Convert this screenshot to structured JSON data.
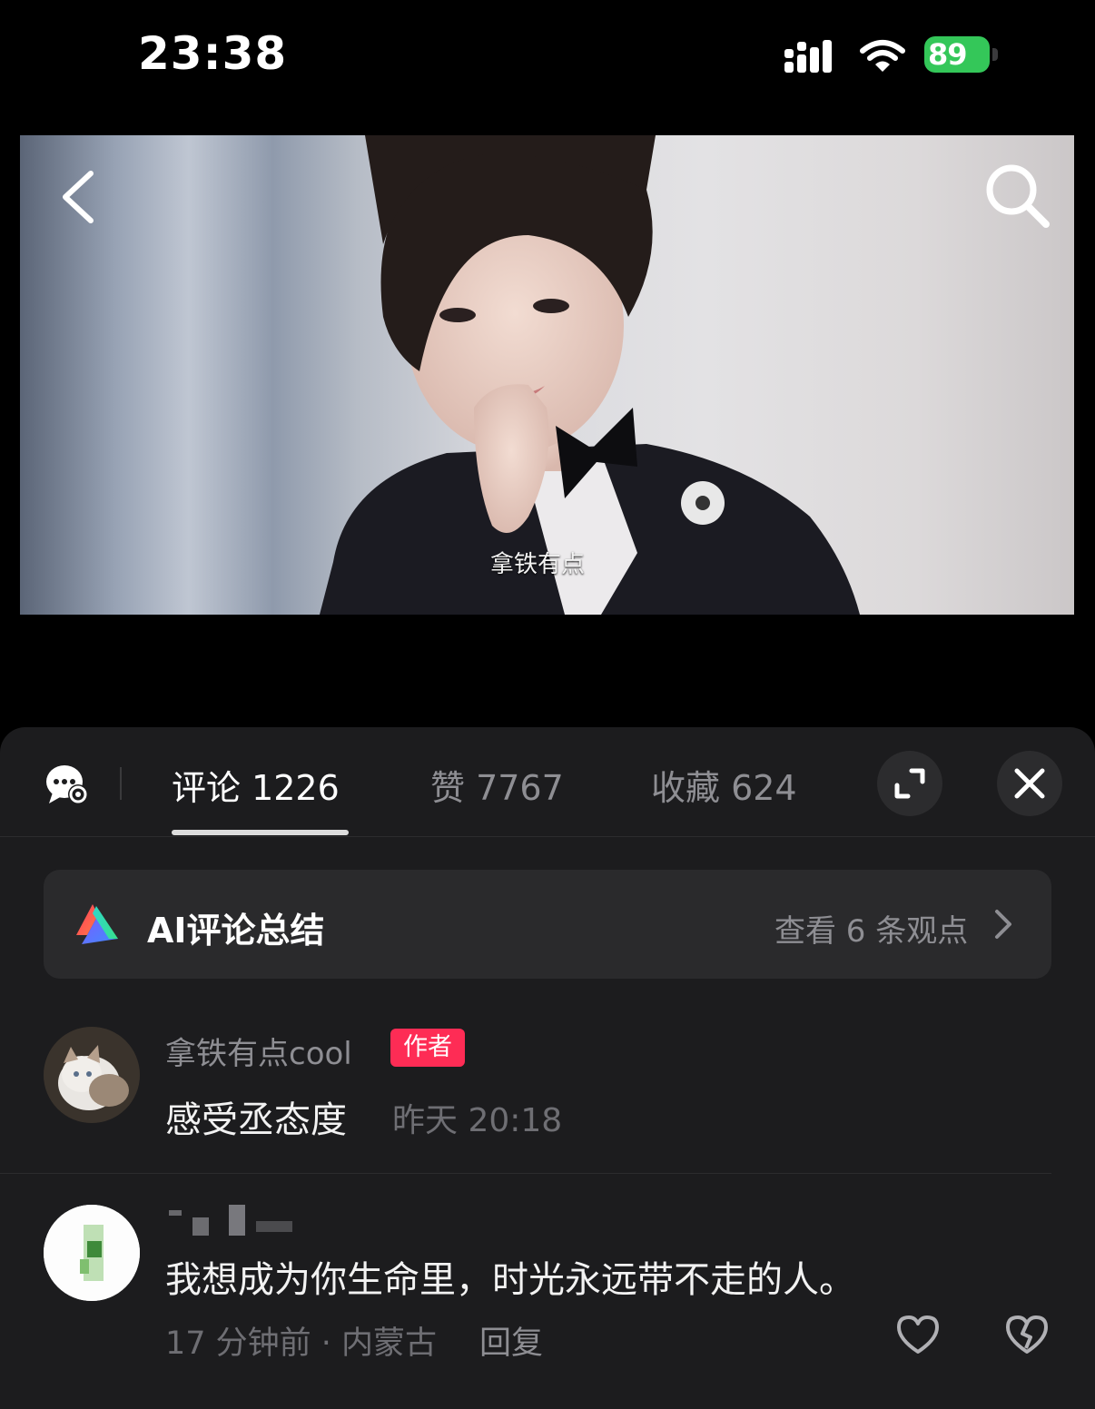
{
  "status_bar": {
    "time": "23:38",
    "battery": "89"
  },
  "post": {
    "watermark": "拿铁有点"
  },
  "tabs": {
    "comments": "评论 1226",
    "likes": "赞 7767",
    "favorites": "收藏 624"
  },
  "ai_summary": {
    "title": "AI评论总结",
    "link": "查看 6 条观点"
  },
  "comments": [
    {
      "username": "拿铁有点cool",
      "badge": "作者",
      "text": "感受丞态度",
      "time": "昨天 20:18"
    },
    {
      "username": "",
      "text": "我想成为你生命里，时光永远带不走的人。",
      "meta": "17 分钟前 · 内蒙古",
      "reply": "回复"
    }
  ],
  "colors": {
    "accent_badge": "#fe2c55",
    "battery": "#34c759",
    "sheet_bg": "#1c1c1e",
    "card_bg": "#2a2a2c"
  },
  "icons": [
    "signal-icon",
    "wifi-icon",
    "back-chevron-icon",
    "search-icon",
    "chat-settings-icon",
    "expand-icon",
    "close-icon",
    "ai-logo-icon",
    "chevron-right-icon",
    "heart-icon",
    "dislike-icon"
  ]
}
